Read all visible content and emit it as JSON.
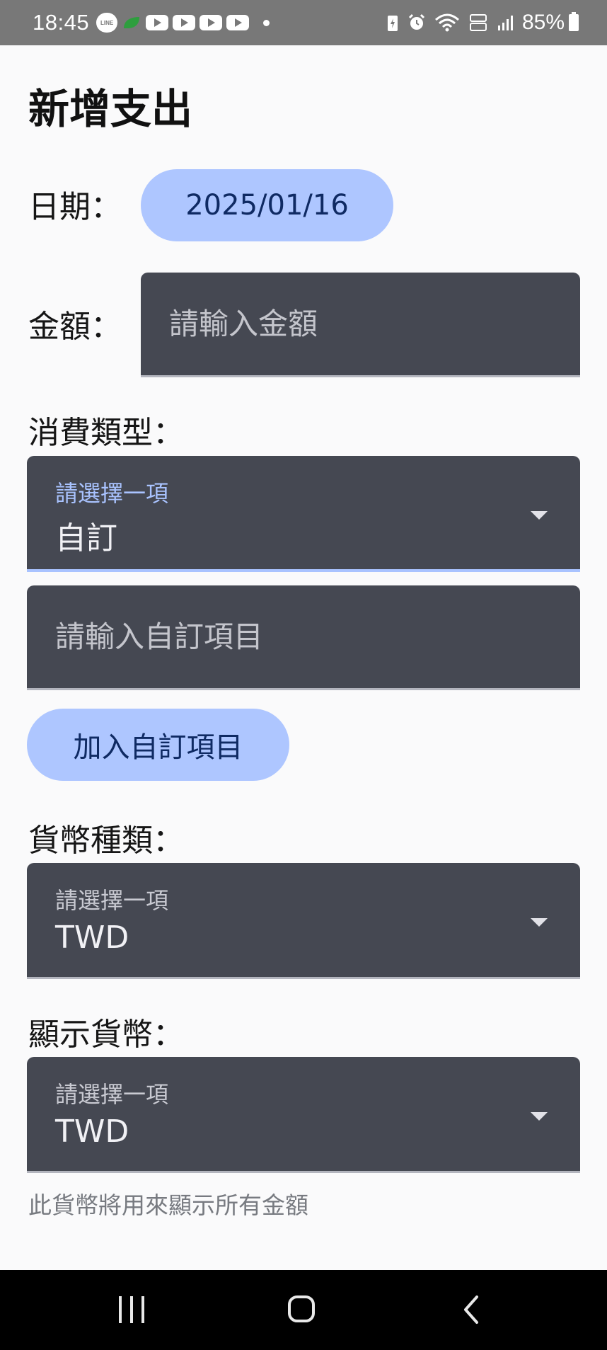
{
  "status_bar": {
    "time": "18:45",
    "line_label": "LINE",
    "battery": "85%",
    "icons": [
      "line-icon",
      "leaf-icon",
      "youtube-icon",
      "youtube-icon",
      "youtube-icon",
      "youtube-icon",
      "dot-icon",
      "battery-saver-icon",
      "alarm-icon",
      "wifi-icon",
      "volte-icon",
      "signal-icon",
      "battery-icon"
    ]
  },
  "page": {
    "title": "新增支出"
  },
  "date": {
    "label": "日期：",
    "value": "2025/01/16"
  },
  "amount": {
    "label": "金額：",
    "placeholder": "請輸入金額",
    "value": ""
  },
  "category": {
    "label": "消費類型：",
    "select_hint": "請選擇一項",
    "selected": "自訂",
    "custom_placeholder": "請輸入自訂項目",
    "add_button_label": "加入自訂項目"
  },
  "currency": {
    "label": "貨幣種類：",
    "select_hint": "請選擇一項",
    "selected": "TWD"
  },
  "display_currency": {
    "label": "顯示貨幣：",
    "select_hint": "請選擇一項",
    "selected": "TWD",
    "helper": "此貨幣將用來顯示所有金額"
  },
  "colors": {
    "accent": "#aec6ff",
    "accent_text": "#0f2a63",
    "field_bg": "#454852",
    "page_bg": "#fafafb",
    "status_bar_bg": "#787878",
    "nav_bar_bg": "#000000"
  }
}
